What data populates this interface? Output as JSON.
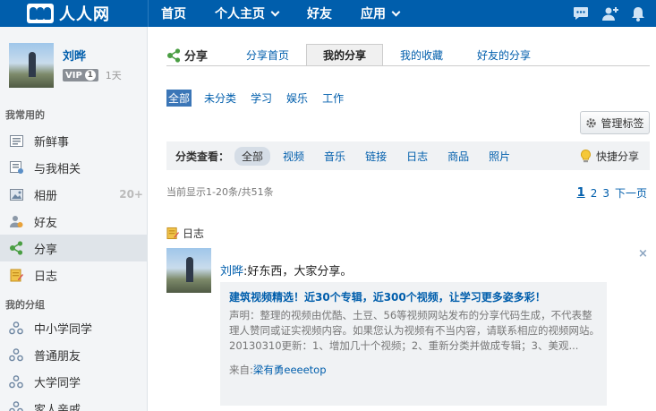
{
  "app": {
    "logo_text": "人人网"
  },
  "nav": [
    {
      "label": "首页",
      "dropdown": false
    },
    {
      "label": "个人主页",
      "dropdown": true
    },
    {
      "label": "好友",
      "dropdown": false
    },
    {
      "label": "应用",
      "dropdown": true
    }
  ],
  "top_icons": [
    "chat-icon",
    "add-friend-icon",
    "bell-icon"
  ],
  "profile": {
    "name": "刘晔",
    "vip_label": "VIP",
    "vip_level": "1",
    "days": "1天"
  },
  "sidebar": {
    "section_common": "我常用的",
    "common_items": [
      {
        "label": "新鲜事",
        "icon": "news-feed-icon",
        "count": ""
      },
      {
        "label": "与我相关",
        "icon": "related-icon",
        "count": ""
      },
      {
        "label": "相册",
        "icon": "album-icon",
        "count": "20+"
      },
      {
        "label": "好友",
        "icon": "friends-icon",
        "count": ""
      },
      {
        "label": "分享",
        "icon": "share-icon",
        "count": "",
        "active": true
      },
      {
        "label": "日志",
        "icon": "blog-icon",
        "count": ""
      }
    ],
    "section_groups": "我的分组",
    "group_items": [
      {
        "label": "中小学同学",
        "icon": "group-icon"
      },
      {
        "label": "普通朋友",
        "icon": "group-icon"
      },
      {
        "label": "大学同学",
        "icon": "group-icon"
      },
      {
        "label": "家人亲戚",
        "icon": "group-icon"
      }
    ]
  },
  "main": {
    "title": "分享",
    "tabs": [
      {
        "label": "分享首页",
        "active": false
      },
      {
        "label": "我的分享",
        "active": true
      },
      {
        "label": "我的收藏",
        "active": false
      },
      {
        "label": "好友的分享",
        "active": false
      }
    ],
    "categories": [
      {
        "label": "全部",
        "active": true
      },
      {
        "label": "未分类",
        "active": false
      },
      {
        "label": "学习",
        "active": false
      },
      {
        "label": "娱乐",
        "active": false
      },
      {
        "label": "工作",
        "active": false
      }
    ],
    "manage_tags_label": "管理标签",
    "filter": {
      "label": "分类查看：",
      "options": [
        {
          "label": "全部",
          "active": true
        },
        {
          "label": "视频",
          "active": false
        },
        {
          "label": "音乐",
          "active": false
        },
        {
          "label": "链接",
          "active": false
        },
        {
          "label": "日志",
          "active": false
        },
        {
          "label": "商品",
          "active": false
        },
        {
          "label": "照片",
          "active": false
        }
      ],
      "quick_share_label": "快捷分享"
    },
    "count_text": "当前显示1-20条/共51条",
    "pager": {
      "pages": [
        "1",
        "2",
        "3"
      ],
      "current": "1",
      "next_label": "下一页"
    },
    "feed": {
      "type_label": "日志",
      "author": "刘晔",
      "comment": ":好东西，大家分享。",
      "close_label": "×",
      "card_title": "建筑视频精选！近30个专辑，近300个视频，让学习更多姿多彩！",
      "card_desc": "声明：整理的视频由优酷、土豆、56等视频网站发布的分享代码生成，不代表整理人赞同或证实视频内容。如果您认为视频有不当内容，请联系相应的视频网站。 20130310更新：1、增加几十个视频；2、重新分类并做成专辑；3、美观...",
      "source_prefix": "来自:",
      "source_name": "梁有勇eeeetop"
    }
  },
  "colors": {
    "brand": "#005eac",
    "sidebar_bg": "#f3f5f7",
    "active_tab_bg": "#f0f0f0"
  }
}
